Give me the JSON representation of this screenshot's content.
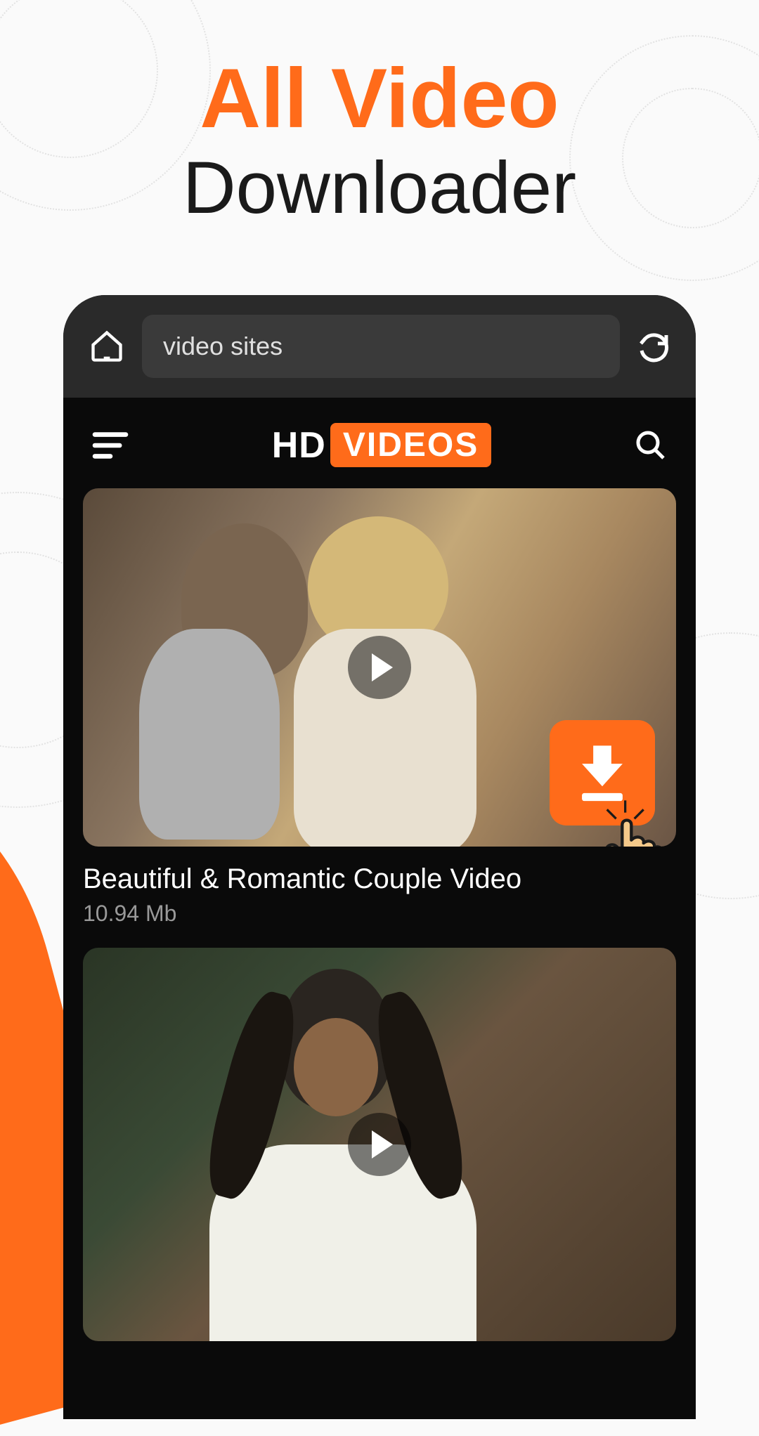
{
  "headline": {
    "line1": "All Video",
    "line2": "Downloader"
  },
  "browser": {
    "url_placeholder": "video sites"
  },
  "logo": {
    "prefix": "HD",
    "badge": "VIDEOS"
  },
  "videos": [
    {
      "title": "Beautiful & Romantic Couple Video",
      "size": "10.94 Mb"
    }
  ],
  "colors": {
    "accent": "#ff6b1a"
  }
}
